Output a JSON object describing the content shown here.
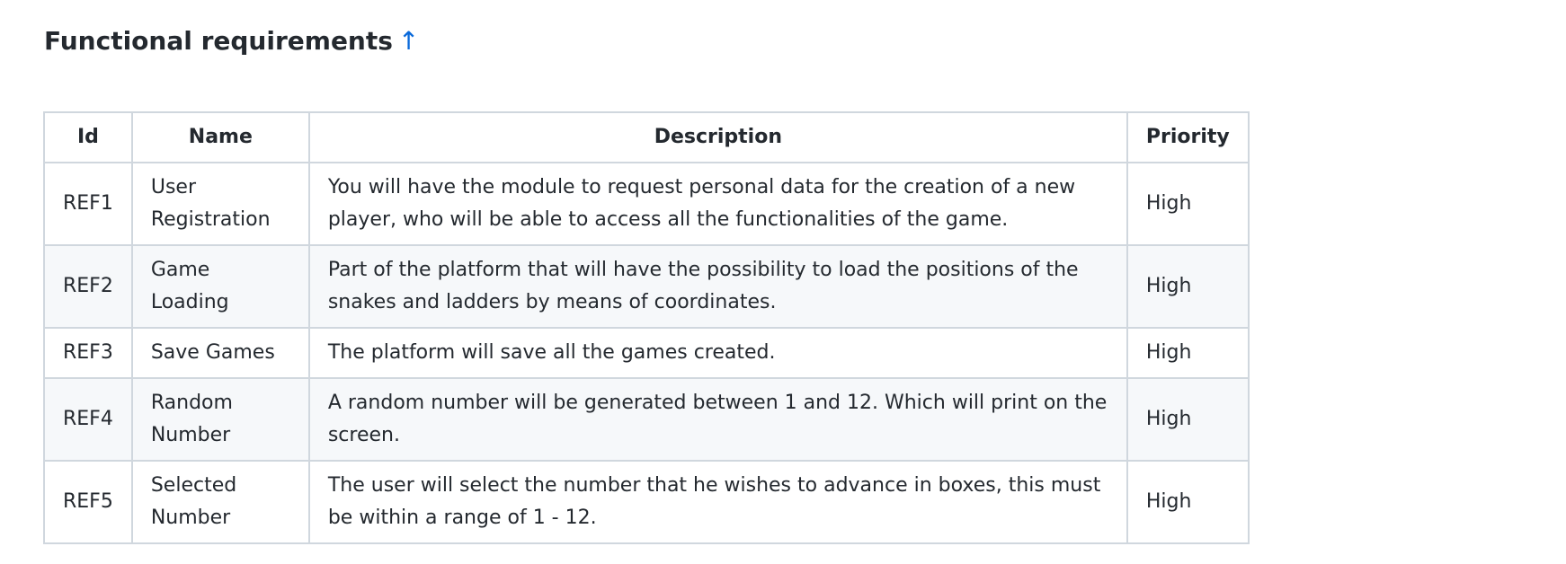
{
  "heading": {
    "title": "Functional requirements",
    "anchor_glyph": "↑"
  },
  "table": {
    "headers": [
      "Id",
      "Name",
      "Description",
      "Priority"
    ],
    "rows": [
      {
        "id": "REF1",
        "name": "User Registration",
        "description": "You will have the module to request personal data for the creation of a new player, who will be able to access all the functionalities of the game.",
        "priority": "High"
      },
      {
        "id": "REF2",
        "name": "Game Loading",
        "description": "Part of the platform that will have the possibility to load the positions of the snakes and ladders by means of coordinates.",
        "priority": "High"
      },
      {
        "id": "REF3",
        "name": "Save Games",
        "description": "The platform will save all the games created.",
        "priority": "High"
      },
      {
        "id": "REF4",
        "name": "Random Number",
        "description": "A random number will be generated between 1 and 12. Which will print on the screen.",
        "priority": "High"
      },
      {
        "id": "REF5",
        "name": "Selected Number",
        "description": "The user will select the number that he wishes to advance in boxes, this must be within a range of 1 - 12.",
        "priority": "High"
      }
    ]
  },
  "colors": {
    "text": "#24292f",
    "link": "#0969da",
    "border": "#d0d7de",
    "stripe": "#f6f8fa"
  }
}
